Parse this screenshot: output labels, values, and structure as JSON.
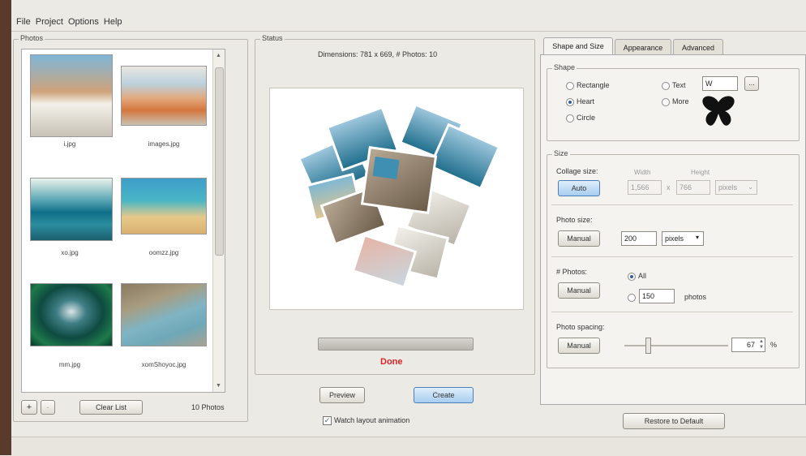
{
  "menu": [
    "File",
    "Project",
    "Options",
    "Help"
  ],
  "photos": {
    "title": "Photos",
    "items": [
      {
        "filename": "i.jpg"
      },
      {
        "filename": "images.jpg"
      },
      {
        "filename": "xo.jpg"
      },
      {
        "filename": "oomzz.jpg"
      },
      {
        "filename": "mm.jpg"
      },
      {
        "filename": "xomShoyoc.jpg"
      }
    ],
    "add_label": "+",
    "remove_label": "-",
    "clear_label": "Clear List",
    "count_text": "10 Photos"
  },
  "status": {
    "title": "Status",
    "dimensions_text": "Dimensions: 781 x 669, # Photos: 10",
    "progress": 1.0,
    "state_text": "Done",
    "preview_label": "Preview",
    "create_label": "Create",
    "watch_label": "Watch layout animation"
  },
  "tabs": [
    {
      "label": "Shape and Size"
    },
    {
      "label": "Appearance"
    },
    {
      "label": "Advanced"
    }
  ],
  "shape": {
    "title": "Shape",
    "options": {
      "rectangle": "Rectangle",
      "heart": "Heart",
      "circle": "Circle",
      "text": "Text",
      "more": "More"
    },
    "selected": "heart",
    "text_value": "W",
    "browse_label": "..."
  },
  "size": {
    "title": "Size",
    "collage_size_label": "Collage size:",
    "auto_label": "Auto",
    "width_label": "Width",
    "height_label": "Height",
    "width_value": "1,566",
    "times": "x",
    "height_value": "766",
    "unit_value": "pixels",
    "photo_size_label": "Photo size:",
    "photo_size_manual": "Manual",
    "photo_size_value": "200",
    "photo_size_unit": "pixels",
    "num_photos_label": "# Photos:",
    "num_photos_manual": "Manual",
    "all_label": "All",
    "photos_value": "150",
    "photos_unit": "photos",
    "spacing_label": "Photo spacing:",
    "spacing_manual": "Manual",
    "spacing_value": "67",
    "spacing_unit": "%"
  },
  "restore_label": "Restore to Default",
  "colors": {
    "done": "#d9232a",
    "accent": "#2f5f9e"
  }
}
